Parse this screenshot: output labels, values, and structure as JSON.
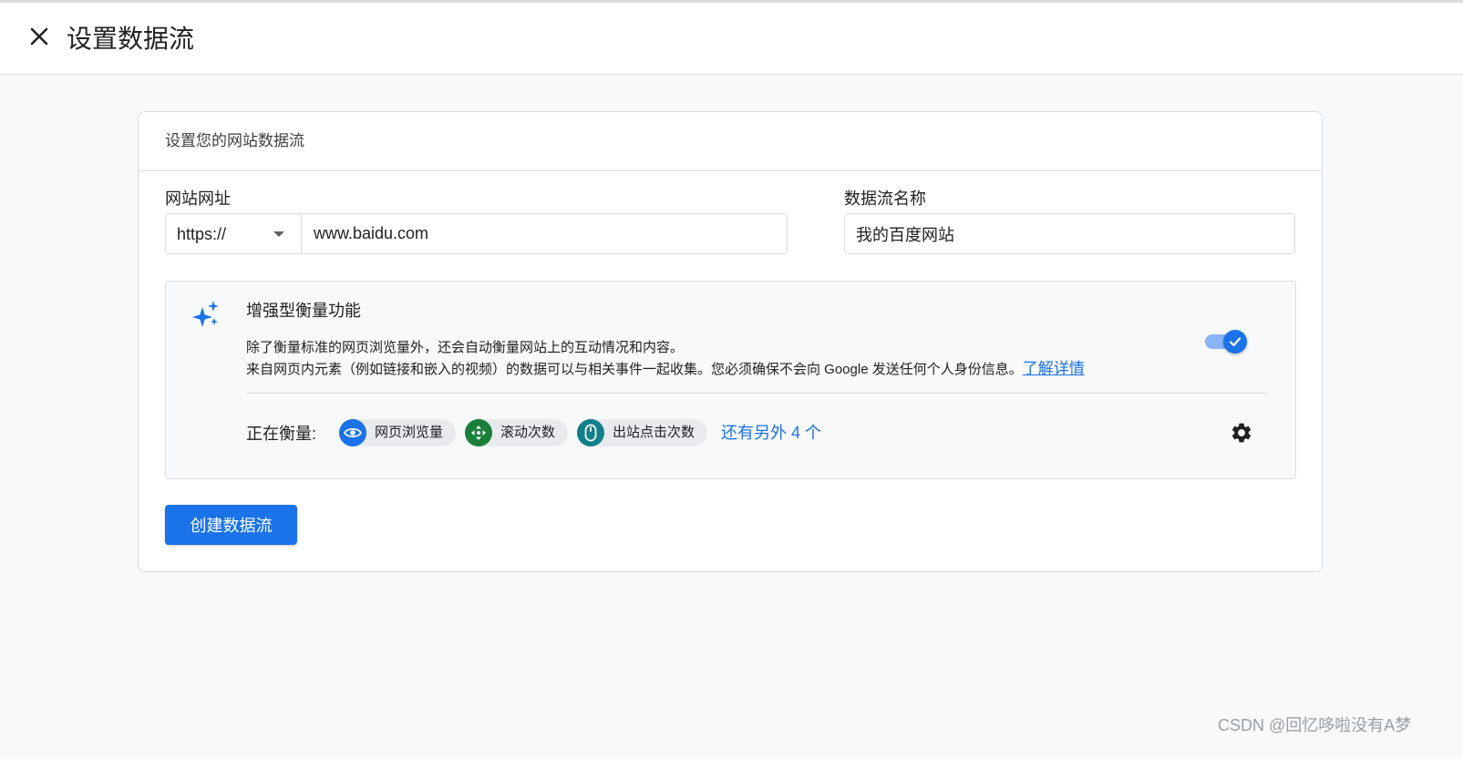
{
  "header": {
    "title": "设置数据流",
    "close_icon": "close-icon"
  },
  "card": {
    "heading": "设置您的网站数据流",
    "url_field": {
      "label": "网站网址",
      "protocol": "https://",
      "value": "www.baidu.com"
    },
    "name_field": {
      "label": "数据流名称",
      "value": "我的百度网站"
    },
    "enhanced_measurement": {
      "icon": "sparkle-icon",
      "title": "增强型衡量功能",
      "desc_line1": "除了衡量标准的网页浏览量外，还会自动衡量网站上的互动情况和内容。",
      "desc_line2": "来自网页内元素（例如链接和嵌入的视频）的数据可以与相关事件一起收集。您必须确保不会向 Google 发送任何个人身份信息。",
      "learn_more": "了解详情",
      "enabled": true,
      "measuring_label": "正在衡量:",
      "chips": [
        {
          "label": "网页浏览量",
          "icon": "eye-icon",
          "color": "#1a73e8"
        },
        {
          "label": "滚动次数",
          "icon": "scroll-icon",
          "color": "#188038"
        },
        {
          "label": "出站点击次数",
          "icon": "mouse-icon",
          "color": "#12808a"
        }
      ],
      "more": "还有另外 4 个",
      "settings_icon": "gear-icon"
    },
    "create_button": "创建数据流"
  },
  "watermark": "CSDN @回忆哆啦没有A梦",
  "colors": {
    "accent": "#1a73e8",
    "toggle_track": "#8ab4f8",
    "border": "#dadce0",
    "background": "#f8f9fa"
  }
}
